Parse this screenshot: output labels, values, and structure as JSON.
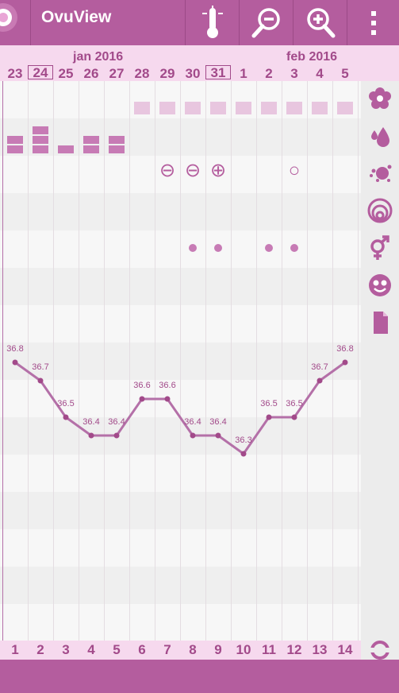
{
  "app": {
    "title": "OvuView"
  },
  "toolbar": {
    "thermometer_icon": "thermometer-icon",
    "zoom_out_icon": "zoom-out-icon",
    "zoom_in_icon": "zoom-in-icon",
    "menu_icon": "overflow-menu-icon"
  },
  "header": {
    "months": [
      "jan 2016",
      "feb 2016"
    ],
    "dates": [
      "23",
      "24",
      "25",
      "26",
      "27",
      "28",
      "29",
      "30",
      "31",
      "1",
      "2",
      "3",
      "4",
      "5"
    ],
    "today_index": 1,
    "highlight_index": 8
  },
  "cycle_days": [
    "1",
    "2",
    "3",
    "4",
    "5",
    "6",
    "7",
    "8",
    "9",
    "10",
    "11",
    "12",
    "13",
    "14"
  ],
  "rows": {
    "spotting_days": [
      5,
      6,
      7,
      8,
      9,
      10,
      11,
      12,
      13
    ],
    "flow_levels": [
      2,
      3,
      1,
      2,
      2,
      0,
      0,
      0,
      0,
      0,
      0,
      0,
      0,
      0
    ],
    "tests": [
      {
        "index": 6,
        "symbol": "⊖"
      },
      {
        "index": 7,
        "symbol": "⊖"
      },
      {
        "index": 8,
        "symbol": "⊕"
      },
      {
        "index": 11,
        "symbol": "○"
      }
    ],
    "intercourse_days": [
      7,
      8,
      10,
      11
    ]
  },
  "sidebar_icons": [
    "flower-icon",
    "drop-icon",
    "splash-icon",
    "cervix-icon",
    "gender-icon",
    "smiley-icon",
    "note-icon",
    "sync-icon"
  ],
  "colors": {
    "primary": "#b45d9e",
    "accent": "#a24a8a",
    "light": "#f6d9ee",
    "line": "#b470a8"
  },
  "chart_data": {
    "type": "line",
    "x": [
      "1",
      "2",
      "3",
      "4",
      "5",
      "6",
      "7",
      "8",
      "9",
      "10",
      "11",
      "12",
      "13",
      "14"
    ],
    "series": [
      {
        "values": [
          36.8,
          36.7,
          36.5,
          36.4,
          36.4,
          36.6,
          36.6,
          36.4,
          36.4,
          36.3,
          36.5,
          36.5,
          36.7,
          36.8
        ]
      }
    ],
    "labels": [
      "36.8",
      "36.7",
      "36.5",
      "36.4",
      "36.4",
      "36.6",
      "36.6",
      "36.4",
      "36.4",
      "36.3",
      "36.5",
      "36.5",
      "36.7",
      "36.8"
    ]
  }
}
